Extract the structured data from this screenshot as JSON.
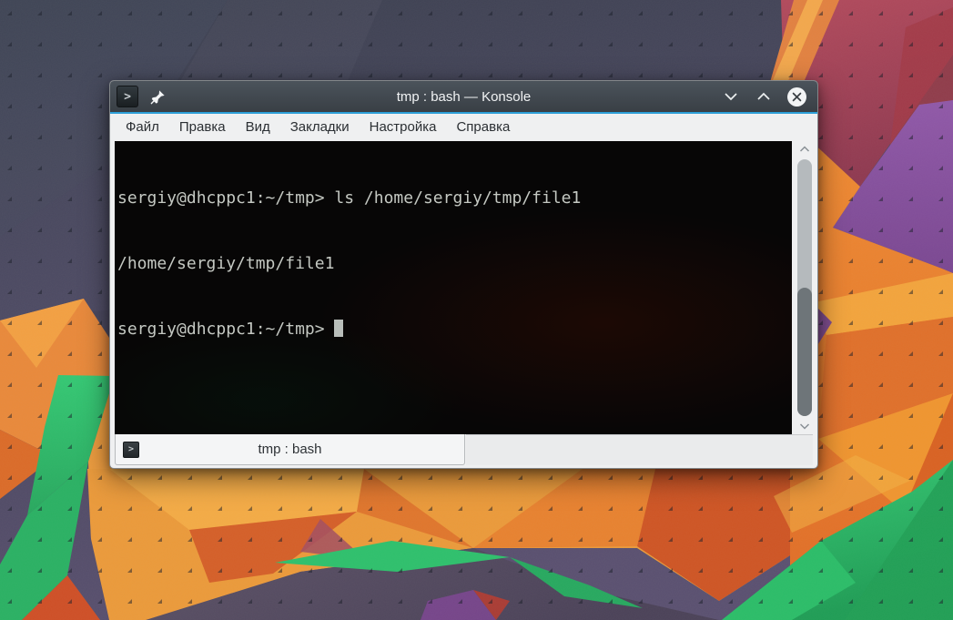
{
  "window": {
    "title": "tmp : bash — Konsole",
    "titlebar": {
      "app_icon_glyph": ">",
      "icons": {
        "app": "terminal-prompt-square",
        "pin": "pushpin",
        "minimize": "chevron-down",
        "maximize": "chevron-up",
        "close": "circle-with-x"
      }
    },
    "menu": {
      "items": [
        "Файл",
        "Правка",
        "Вид",
        "Закладки",
        "Настройка",
        "Справка"
      ]
    },
    "terminal": {
      "line1_prompt": "sergiy@dhcppc1:~/tmp>",
      "line1_command": "ls /home/sergiy/tmp/file1",
      "line2_output": "/home/sergiy/tmp/file1",
      "line3_prompt": "sergiy@dhcppc1:~/tmp>",
      "cursor": "block"
    },
    "scrollbar": {
      "icons": {
        "up": "chevron-up",
        "down": "chevron-down"
      }
    },
    "tabbar": {
      "tab_label": "tmp : bash",
      "tab_icon_glyph": ">"
    },
    "colors": {
      "accent_blue": "#2d9fd8",
      "titlebar_top": "#4b535b",
      "titlebar_bottom": "#393f45",
      "menubar_bg": "#eff0f1",
      "terminal_bg": "#070606",
      "terminal_text": "#c4c8c2"
    }
  },
  "wallpaper": {
    "palette": {
      "slate": "#3d4251",
      "violet": "#574d6b",
      "orange": "#e78a35",
      "amber": "#f2a843",
      "deep_orange": "#d96222",
      "red_orange": "#cf5226",
      "crimson": "#aa4458",
      "purple": "#8a55a3",
      "green": "#2fc471",
      "dark_green": "#1f9d55"
    }
  }
}
